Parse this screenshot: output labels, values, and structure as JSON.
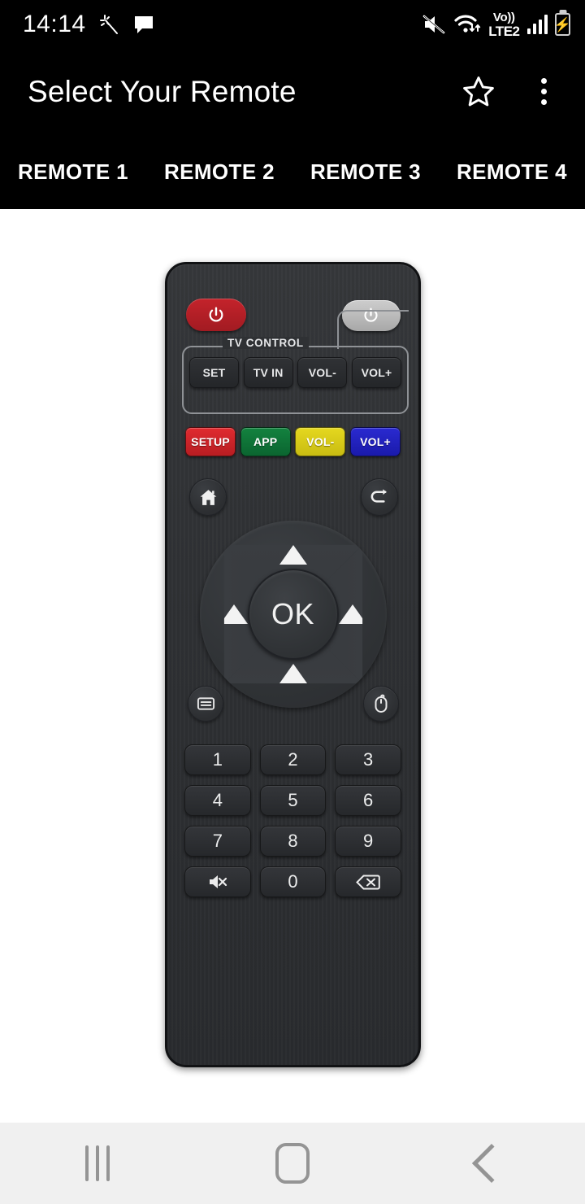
{
  "status_bar": {
    "time": "14:14",
    "icons_left": [
      "magic-wand-icon",
      "message-bubble-icon"
    ],
    "icons_right": [
      "mute-icon",
      "wifi-icon",
      "volte-icon",
      "signal-bars-icon",
      "battery-charging-icon"
    ],
    "volte_line1": "Vo))",
    "volte_line2": "LTE2",
    "signal_bars": 4,
    "battery_charging": true
  },
  "app_bar": {
    "title": "Select Your Remote",
    "favorite_icon": "star-outline-icon",
    "overflow_icon": "three-dot-menu-icon"
  },
  "tabs": {
    "active_index": 0,
    "items": [
      {
        "label": "REMOTE 1"
      },
      {
        "label": "REMOTE 2"
      },
      {
        "label": "REMOTE 3"
      },
      {
        "label": "REMOTE 4"
      }
    ]
  },
  "remote": {
    "power_red": {
      "icon": "power-icon",
      "color": "#c4232b"
    },
    "power_gray": {
      "icon": "power-icon",
      "color": "#c2c2c2"
    },
    "tv_control": {
      "label": "TV CONTROL",
      "buttons": [
        {
          "label": "SET"
        },
        {
          "label": "TV IN"
        },
        {
          "label": "VOL-"
        },
        {
          "label": "VOL+"
        }
      ]
    },
    "color_buttons": [
      {
        "label": "SETUP",
        "color": "#d8262c"
      },
      {
        "label": "APP",
        "color": "#0f7538"
      },
      {
        "label": "VOL-",
        "color": "#ddd11b"
      },
      {
        "label": "VOL+",
        "color": "#2222c4"
      }
    ],
    "nav_icons": {
      "home": "home-icon",
      "back": "return-arrow-icon",
      "menu": "menu-list-icon",
      "mouse": "mouse-pointer-icon"
    },
    "dpad": {
      "up": "arrow-up-icon",
      "down": "arrow-down-icon",
      "left": "arrow-left-icon",
      "right": "arrow-right-icon",
      "center_label": "OK"
    },
    "numpad": [
      {
        "label": "1",
        "type": "digit"
      },
      {
        "label": "2",
        "type": "digit"
      },
      {
        "label": "3",
        "type": "digit"
      },
      {
        "label": "4",
        "type": "digit"
      },
      {
        "label": "5",
        "type": "digit"
      },
      {
        "label": "6",
        "type": "digit"
      },
      {
        "label": "7",
        "type": "digit"
      },
      {
        "label": "8",
        "type": "digit"
      },
      {
        "label": "9",
        "type": "digit"
      },
      {
        "label": "",
        "type": "mute-icon"
      },
      {
        "label": "0",
        "type": "digit"
      },
      {
        "label": "",
        "type": "backspace-icon"
      }
    ]
  },
  "nav_bar": {
    "recents": "recents-icon",
    "home": "home-square-icon",
    "back": "back-chevron-icon"
  }
}
